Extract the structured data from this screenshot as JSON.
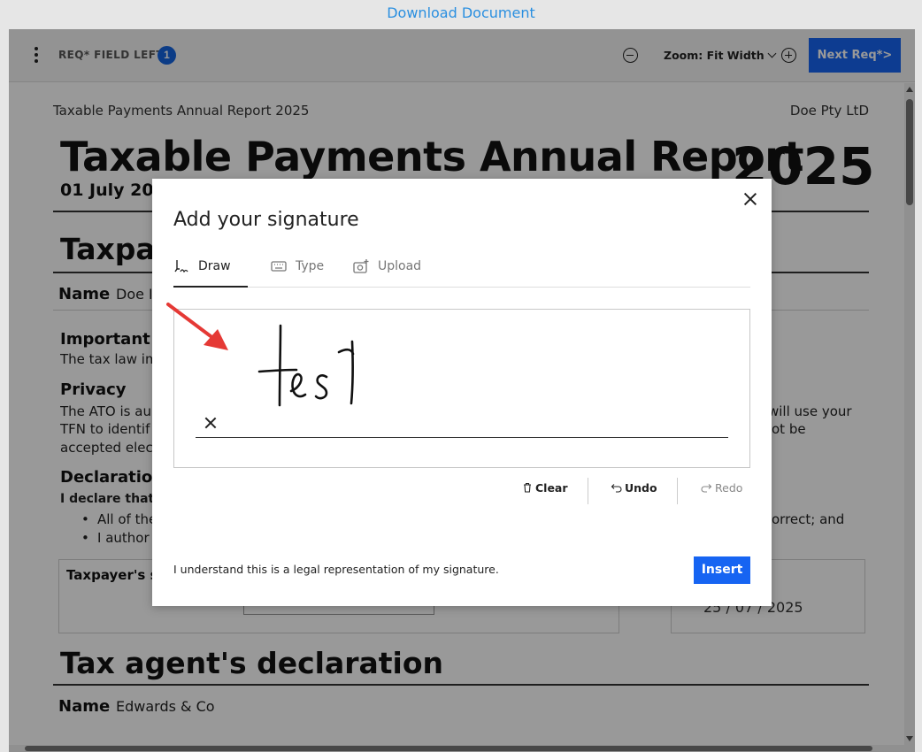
{
  "header": {
    "download_link": "Download Document"
  },
  "toolbar": {
    "required_label": "REQ* FIELD LEFT",
    "required_count": "1",
    "zoom_label": "Zoom: Fit Width",
    "next_button": "Next Req*>"
  },
  "document": {
    "header_left": "Taxable Payments Annual Report 2025",
    "header_right": "Doe Pty LtD",
    "title": "Taxable Payments Annual Report",
    "year": "2025",
    "period": "01 July 202",
    "taxpayer_section": "Taxpay",
    "name_label": "Name",
    "taxpayer_name": "Doe P",
    "important_title": "Important",
    "important_text": "The tax law im",
    "privacy_title": "Privacy",
    "privacy_line1_left": "The ATO is au",
    "privacy_line1_right": "will use your",
    "privacy_line2_left": "TFN to identif",
    "privacy_line2_right": "ot be",
    "privacy_line3": "accepted elec",
    "declaration_title": "Declaration",
    "declare_that": "I declare that:",
    "bullet1_left": "All of the",
    "bullet1_right": "orrect; and",
    "bullet2_left": "I author",
    "signature_label": "Taxpayer's si",
    "date_value": "25 / 07 / 2025",
    "agent_section": "Tax agent's declaration",
    "agent_name_label": "Name",
    "agent_name": "Edwards & Co"
  },
  "modal": {
    "title": "Add your signature",
    "tabs": [
      {
        "label": "Draw",
        "icon": "pen-signature-icon",
        "active": true
      },
      {
        "label": "Type",
        "icon": "keyboard-icon",
        "active": false
      },
      {
        "label": "Upload",
        "icon": "camera-upload-icon",
        "active": false
      }
    ],
    "drawn_signature": "test",
    "actions": {
      "clear": "Clear",
      "undo": "Undo",
      "redo": "Redo"
    },
    "legal_note": "I understand this is a legal representation of my signature.",
    "insert_button": "Insert"
  },
  "colors": {
    "accent": "#1664f2",
    "link": "#2a8fe0",
    "annotation_arrow": "#e53935"
  }
}
